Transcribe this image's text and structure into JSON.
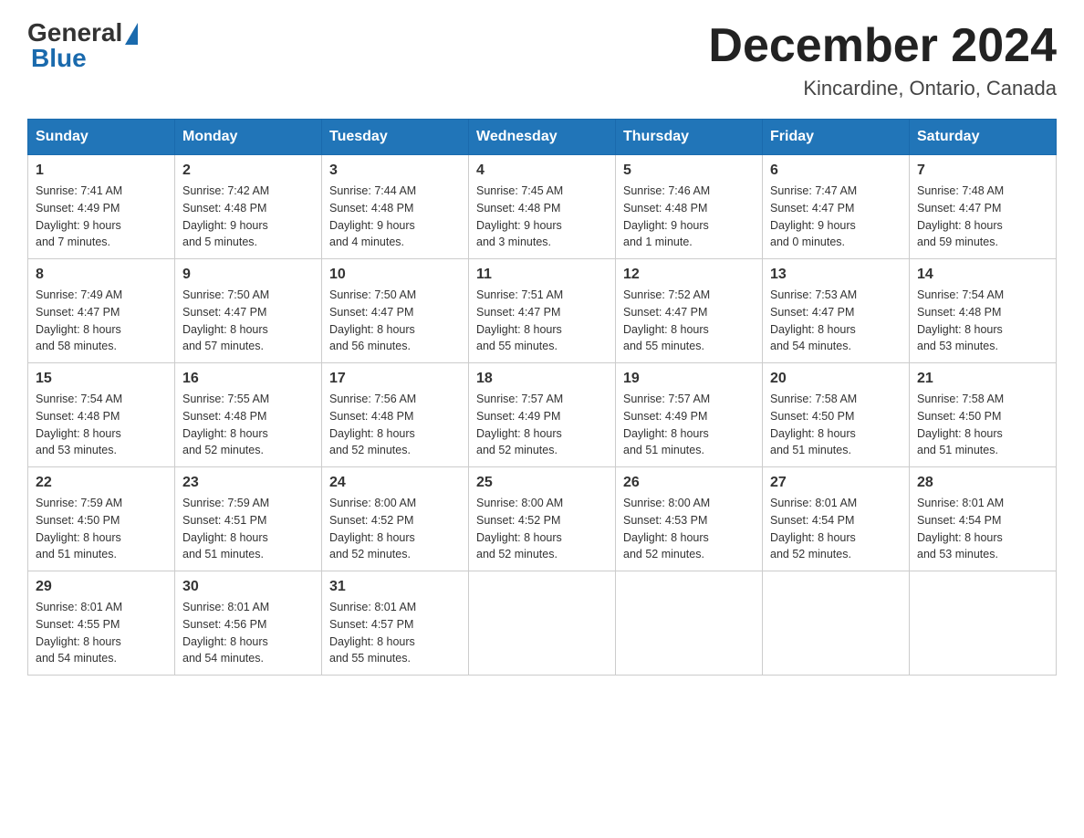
{
  "header": {
    "logo_general": "General",
    "logo_blue": "Blue",
    "month": "December 2024",
    "location": "Kincardine, Ontario, Canada"
  },
  "days_of_week": [
    "Sunday",
    "Monday",
    "Tuesday",
    "Wednesday",
    "Thursday",
    "Friday",
    "Saturday"
  ],
  "weeks": [
    [
      {
        "day": "1",
        "sunrise": "7:41 AM",
        "sunset": "4:49 PM",
        "daylight": "9 hours and 7 minutes."
      },
      {
        "day": "2",
        "sunrise": "7:42 AM",
        "sunset": "4:48 PM",
        "daylight": "9 hours and 5 minutes."
      },
      {
        "day": "3",
        "sunrise": "7:44 AM",
        "sunset": "4:48 PM",
        "daylight": "9 hours and 4 minutes."
      },
      {
        "day": "4",
        "sunrise": "7:45 AM",
        "sunset": "4:48 PM",
        "daylight": "9 hours and 3 minutes."
      },
      {
        "day": "5",
        "sunrise": "7:46 AM",
        "sunset": "4:48 PM",
        "daylight": "9 hours and 1 minute."
      },
      {
        "day": "6",
        "sunrise": "7:47 AM",
        "sunset": "4:47 PM",
        "daylight": "9 hours and 0 minutes."
      },
      {
        "day": "7",
        "sunrise": "7:48 AM",
        "sunset": "4:47 PM",
        "daylight": "8 hours and 59 minutes."
      }
    ],
    [
      {
        "day": "8",
        "sunrise": "7:49 AM",
        "sunset": "4:47 PM",
        "daylight": "8 hours and 58 minutes."
      },
      {
        "day": "9",
        "sunrise": "7:50 AM",
        "sunset": "4:47 PM",
        "daylight": "8 hours and 57 minutes."
      },
      {
        "day": "10",
        "sunrise": "7:50 AM",
        "sunset": "4:47 PM",
        "daylight": "8 hours and 56 minutes."
      },
      {
        "day": "11",
        "sunrise": "7:51 AM",
        "sunset": "4:47 PM",
        "daylight": "8 hours and 55 minutes."
      },
      {
        "day": "12",
        "sunrise": "7:52 AM",
        "sunset": "4:47 PM",
        "daylight": "8 hours and 55 minutes."
      },
      {
        "day": "13",
        "sunrise": "7:53 AM",
        "sunset": "4:47 PM",
        "daylight": "8 hours and 54 minutes."
      },
      {
        "day": "14",
        "sunrise": "7:54 AM",
        "sunset": "4:48 PM",
        "daylight": "8 hours and 53 minutes."
      }
    ],
    [
      {
        "day": "15",
        "sunrise": "7:54 AM",
        "sunset": "4:48 PM",
        "daylight": "8 hours and 53 minutes."
      },
      {
        "day": "16",
        "sunrise": "7:55 AM",
        "sunset": "4:48 PM",
        "daylight": "8 hours and 52 minutes."
      },
      {
        "day": "17",
        "sunrise": "7:56 AM",
        "sunset": "4:48 PM",
        "daylight": "8 hours and 52 minutes."
      },
      {
        "day": "18",
        "sunrise": "7:57 AM",
        "sunset": "4:49 PM",
        "daylight": "8 hours and 52 minutes."
      },
      {
        "day": "19",
        "sunrise": "7:57 AM",
        "sunset": "4:49 PM",
        "daylight": "8 hours and 51 minutes."
      },
      {
        "day": "20",
        "sunrise": "7:58 AM",
        "sunset": "4:50 PM",
        "daylight": "8 hours and 51 minutes."
      },
      {
        "day": "21",
        "sunrise": "7:58 AM",
        "sunset": "4:50 PM",
        "daylight": "8 hours and 51 minutes."
      }
    ],
    [
      {
        "day": "22",
        "sunrise": "7:59 AM",
        "sunset": "4:50 PM",
        "daylight": "8 hours and 51 minutes."
      },
      {
        "day": "23",
        "sunrise": "7:59 AM",
        "sunset": "4:51 PM",
        "daylight": "8 hours and 51 minutes."
      },
      {
        "day": "24",
        "sunrise": "8:00 AM",
        "sunset": "4:52 PM",
        "daylight": "8 hours and 52 minutes."
      },
      {
        "day": "25",
        "sunrise": "8:00 AM",
        "sunset": "4:52 PM",
        "daylight": "8 hours and 52 minutes."
      },
      {
        "day": "26",
        "sunrise": "8:00 AM",
        "sunset": "4:53 PM",
        "daylight": "8 hours and 52 minutes."
      },
      {
        "day": "27",
        "sunrise": "8:01 AM",
        "sunset": "4:54 PM",
        "daylight": "8 hours and 52 minutes."
      },
      {
        "day": "28",
        "sunrise": "8:01 AM",
        "sunset": "4:54 PM",
        "daylight": "8 hours and 53 minutes."
      }
    ],
    [
      {
        "day": "29",
        "sunrise": "8:01 AM",
        "sunset": "4:55 PM",
        "daylight": "8 hours and 54 minutes."
      },
      {
        "day": "30",
        "sunrise": "8:01 AM",
        "sunset": "4:56 PM",
        "daylight": "8 hours and 54 minutes."
      },
      {
        "day": "31",
        "sunrise": "8:01 AM",
        "sunset": "4:57 PM",
        "daylight": "8 hours and 55 minutes."
      },
      null,
      null,
      null,
      null
    ]
  ],
  "labels": {
    "sunrise": "Sunrise:",
    "sunset": "Sunset:",
    "daylight": "Daylight:"
  }
}
